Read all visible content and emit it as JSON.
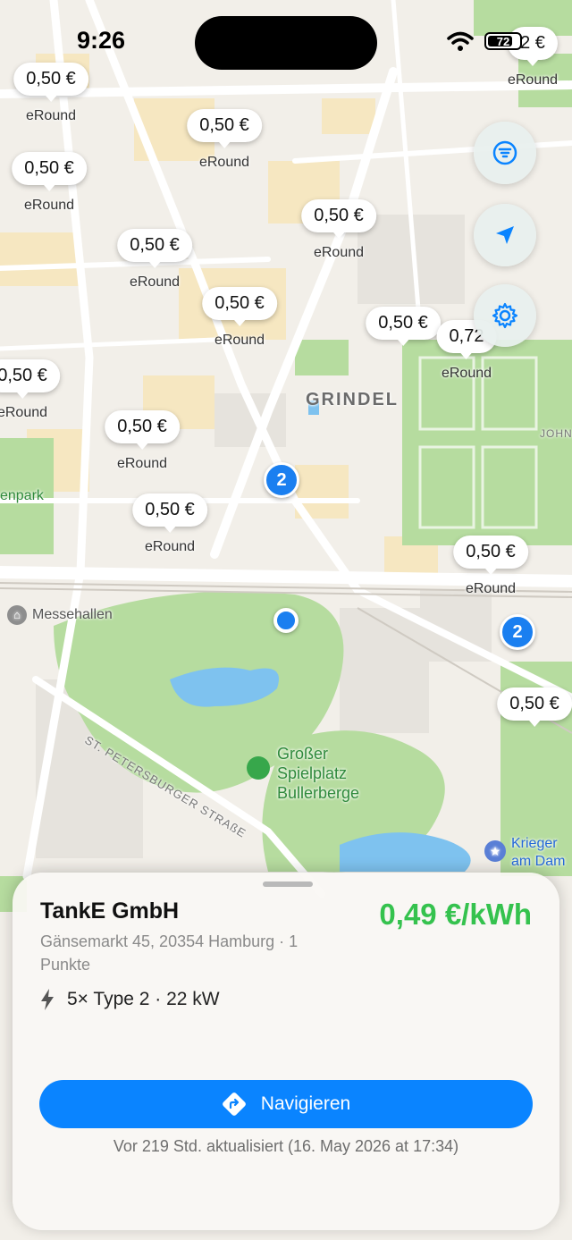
{
  "status_bar": {
    "time": "9:26",
    "battery": "72"
  },
  "map": {
    "price_pins": [
      {
        "price": "0,50 €",
        "label": "eRound"
      },
      {
        "price": "0,50 €",
        "label": "eRound"
      },
      {
        "price": "0,50 €",
        "label": "eRound"
      },
      {
        "price": "0,50 €",
        "label": "eRound"
      },
      {
        "price": "0,50 €",
        "label": "eRound"
      },
      {
        "price": "0,50 €",
        "label": "eRound"
      },
      {
        "price": "0,50 €",
        "label": "eRound"
      },
      {
        "price": "0,50 €",
        "label": "eRound"
      },
      {
        "price": "0,50 €",
        "label": "eRound"
      },
      {
        "price": "0,50 €",
        "label": "eRound"
      },
      {
        "price": "0,50 €",
        "label": "eRound"
      },
      {
        "price": "0,50 €",
        "label": "eRound"
      },
      {
        "price": "0,72",
        "label": "eRound"
      },
      {
        "price": "2 €",
        "label": "eRound"
      }
    ],
    "clusters": [
      "2",
      "2"
    ],
    "labels": {
      "grindel": "GRINDEL",
      "messehallen": "Messehallen",
      "street": "ST. PETERSBURGER STRAßE",
      "playground": "Großer Spielplatz Bullerberge",
      "park": "enpark",
      "krieger": "Krieger am Dam",
      "john": "JOHN"
    }
  },
  "controls": {
    "filter": "filter-icon",
    "locate": "location-arrow-icon",
    "settings": "gear-icon"
  },
  "sheet": {
    "operator": "TankE GmbH",
    "price": "0,49 €/kWh",
    "address": "Gänsemarkt 45, 20354 Hamburg · 1 Punkte",
    "connector": "5× Type 2 · 22 kW",
    "navigate_label": "Navigieren",
    "updated": "Vor 219 Std. aktualisiert (16. May 2026 at 17:34)"
  },
  "colors": {
    "accent": "#0a84ff",
    "price_green": "#35c24e",
    "park": "#b6dc9f",
    "water": "#7ec2ef"
  }
}
